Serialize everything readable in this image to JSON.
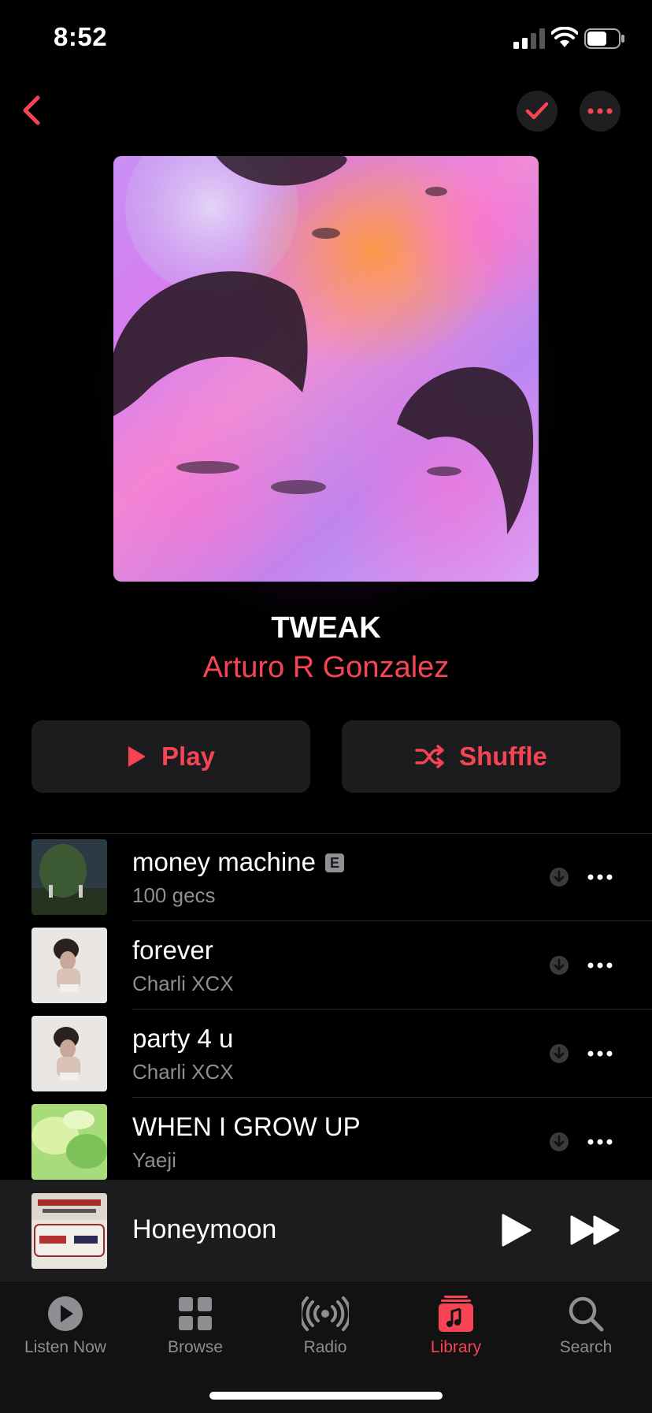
{
  "status": {
    "time": "8:52"
  },
  "album": {
    "title": "TWEAK",
    "artist": "Arturo R Gonzalez"
  },
  "actions": {
    "play": "Play",
    "shuffle": "Shuffle"
  },
  "tracks": [
    {
      "name": "money machine",
      "artist": "100 gecs",
      "explicit": "E"
    },
    {
      "name": "forever",
      "artist": "Charli XCX"
    },
    {
      "name": "party 4 u",
      "artist": "Charli XCX"
    },
    {
      "name": "WHEN I GROW UP",
      "artist": "Yaeji"
    }
  ],
  "mini_player": {
    "track": "Honeymoon"
  },
  "tabs": [
    {
      "label": "Listen Now",
      "icon": "play-circle-icon"
    },
    {
      "label": "Browse",
      "icon": "grid-icon"
    },
    {
      "label": "Radio",
      "icon": "radio-waves-icon"
    },
    {
      "label": "Library",
      "icon": "music-note-icon",
      "active": true
    },
    {
      "label": "Search",
      "icon": "magnifier-icon"
    }
  ],
  "colors": {
    "accent": "#f64454",
    "background": "#000000",
    "secondary_text": "#8e8e93",
    "button_bg": "#1c1c1e"
  }
}
